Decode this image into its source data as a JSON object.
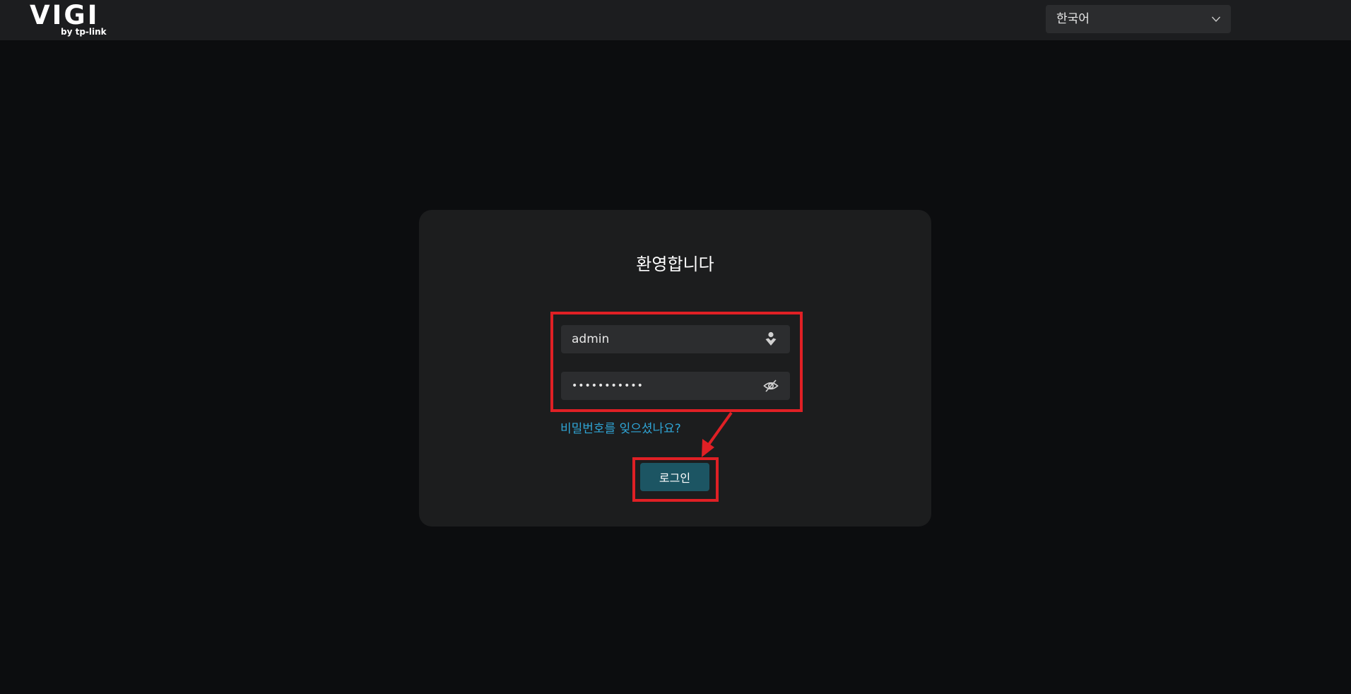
{
  "header": {
    "logo_text": "VIGI",
    "logo_subtext": "by tp-link",
    "language": {
      "selected": "한국어",
      "chevron_icon": "chevron-down-icon"
    }
  },
  "login": {
    "title": "환영합니다",
    "username": {
      "value": "admin",
      "icon": "user-icon"
    },
    "password": {
      "value": "•••••••••••",
      "icon": "eye-slash-icon"
    },
    "forgot_link": "비밀번호를 잊으셨나요?",
    "login_button": "로그인"
  },
  "annotations": {
    "highlight_color": "#e02025"
  },
  "colors": {
    "background": "#0c0d0f",
    "topbar": "#1c1d1f",
    "card": "#1c1d1e",
    "input": "#2c2d2f",
    "link": "#2fa5d6",
    "button": "#1c5563"
  }
}
